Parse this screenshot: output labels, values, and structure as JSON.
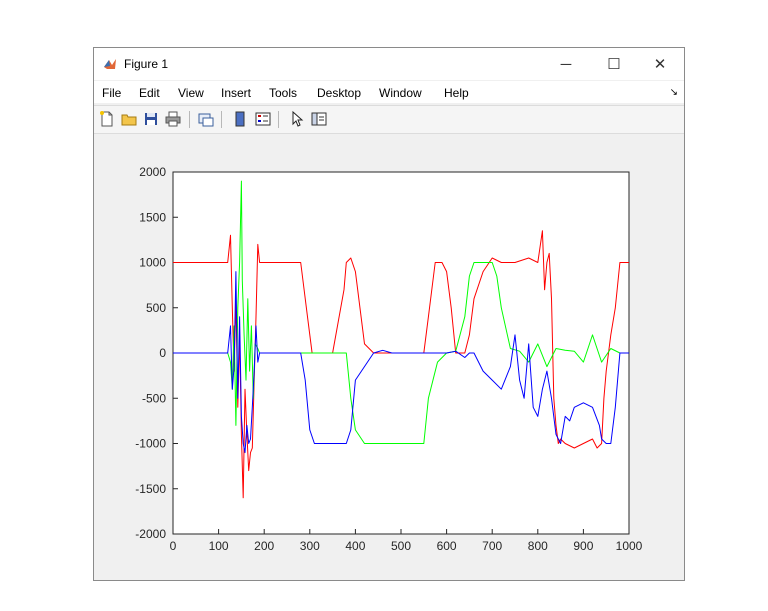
{
  "window": {
    "title": "Figure 1",
    "controls": {
      "minimize": "─",
      "maximize": "☐",
      "close": "✕"
    },
    "dock_icon": "dock-arrow-icon"
  },
  "menu": [
    "File",
    "Edit",
    "View",
    "Insert",
    "Tools",
    "Desktop",
    "Window",
    "Help"
  ],
  "toolbar": {
    "tools": [
      "new-figure-icon",
      "open-file-icon",
      "save-icon",
      "print-icon",
      "link-plot-icon",
      "colorbar-icon",
      "legend-icon",
      "pointer-icon",
      "property-inspector-icon"
    ]
  },
  "colors": {
    "red": "#ff0000",
    "green": "#00ff00",
    "blue": "#0000ff"
  },
  "chart_data": {
    "type": "line",
    "title": "",
    "xlabel": "",
    "ylabel": "",
    "xlim": [
      0,
      1000
    ],
    "ylim": [
      -2000,
      2000
    ],
    "xticks": [
      0,
      100,
      200,
      300,
      400,
      500,
      600,
      700,
      800,
      900,
      1000
    ],
    "yticks": [
      2000,
      1500,
      1000,
      500,
      0,
      -500,
      -1000,
      -1500,
      -2000
    ],
    "grid": false,
    "series": [
      {
        "color": "red",
        "x": [
          0,
          120,
          126,
          130,
          134,
          138,
          142,
          146,
          150,
          154,
          158,
          162,
          166,
          170,
          174,
          178,
          182,
          186,
          190,
          200,
          280,
          295,
          305,
          320,
          350,
          375,
          380,
          390,
          400,
          420,
          440,
          455,
          465,
          480,
          500,
          550,
          560,
          575,
          590,
          600,
          610,
          620,
          640,
          650,
          660,
          680,
          700,
          720,
          750,
          780,
          800,
          810,
          815,
          820,
          825,
          830,
          835,
          840,
          845,
          850,
          860,
          880,
          900,
          920,
          930,
          940,
          945,
          950,
          960,
          970,
          980,
          990,
          1000
        ],
        "y": [
          1000,
          1000,
          1300,
          500,
          -200,
          600,
          -600,
          200,
          -900,
          -1600,
          -400,
          -900,
          -1300,
          -1100,
          -1050,
          -300,
          400,
          1200,
          1000,
          1000,
          1000,
          400,
          0,
          0,
          0,
          700,
          1000,
          1050,
          900,
          100,
          0,
          0,
          0,
          0,
          0,
          0,
          400,
          1000,
          1000,
          900,
          500,
          0,
          0,
          200,
          600,
          900,
          1050,
          1000,
          1000,
          1050,
          1000,
          1350,
          700,
          1000,
          1100,
          600,
          -500,
          -800,
          -1000,
          -950,
          -1000,
          -1050,
          -1000,
          -950,
          -1050,
          -1000,
          -500,
          -200,
          200,
          500,
          1000,
          1000,
          1000
        ]
      },
      {
        "color": "green",
        "x": [
          0,
          120,
          126,
          130,
          134,
          138,
          142,
          146,
          150,
          152,
          156,
          160,
          164,
          168,
          172,
          176,
          180,
          186,
          190,
          200,
          300,
          350,
          380,
          390,
          400,
          420,
          440,
          470,
          500,
          550,
          560,
          580,
          600,
          620,
          640,
          650,
          660,
          680,
          700,
          710,
          720,
          740,
          760,
          780,
          800,
          820,
          840,
          860,
          880,
          900,
          920,
          940,
          960,
          980,
          1000
        ],
        "y": [
          0,
          0,
          -100,
          -400,
          300,
          -800,
          500,
          1000,
          1900,
          800,
          200,
          -300,
          600,
          -200,
          300,
          -500,
          100,
          50,
          0,
          0,
          0,
          0,
          0,
          -500,
          -850,
          -1000,
          -1000,
          -1000,
          -1000,
          -1000,
          -500,
          -100,
          0,
          20,
          400,
          850,
          1000,
          1000,
          1000,
          850,
          500,
          50,
          20,
          -100,
          100,
          -150,
          50,
          30,
          20,
          -100,
          200,
          -100,
          50,
          0,
          0
        ]
      },
      {
        "color": "blue",
        "x": [
          0,
          120,
          126,
          130,
          134,
          138,
          142,
          146,
          150,
          154,
          158,
          162,
          166,
          170,
          174,
          178,
          182,
          186,
          190,
          200,
          280,
          290,
          300,
          310,
          330,
          360,
          380,
          390,
          400,
          440,
          460,
          480,
          500,
          550,
          600,
          620,
          640,
          650,
          660,
          680,
          700,
          720,
          740,
          750,
          760,
          770,
          780,
          790,
          800,
          810,
          820,
          830,
          840,
          850,
          860,
          870,
          880,
          900,
          920,
          935,
          940,
          950,
          960,
          970,
          980,
          1000
        ],
        "y": [
          0,
          0,
          300,
          -400,
          -150,
          900,
          -500,
          400,
          -700,
          -1000,
          -1100,
          -800,
          -1000,
          -950,
          -600,
          -200,
          300,
          -100,
          0,
          0,
          0,
          -300,
          -850,
          -1000,
          -1000,
          -1000,
          -1000,
          -850,
          -300,
          0,
          30,
          0,
          0,
          0,
          0,
          20,
          -50,
          0,
          0,
          -200,
          -300,
          -400,
          -150,
          200,
          -300,
          -500,
          100,
          -600,
          -700,
          -400,
          -200,
          -500,
          -900,
          -1000,
          -700,
          -750,
          -600,
          -550,
          -600,
          -800,
          -950,
          -1000,
          -1000,
          -600,
          0,
          0
        ]
      }
    ]
  }
}
